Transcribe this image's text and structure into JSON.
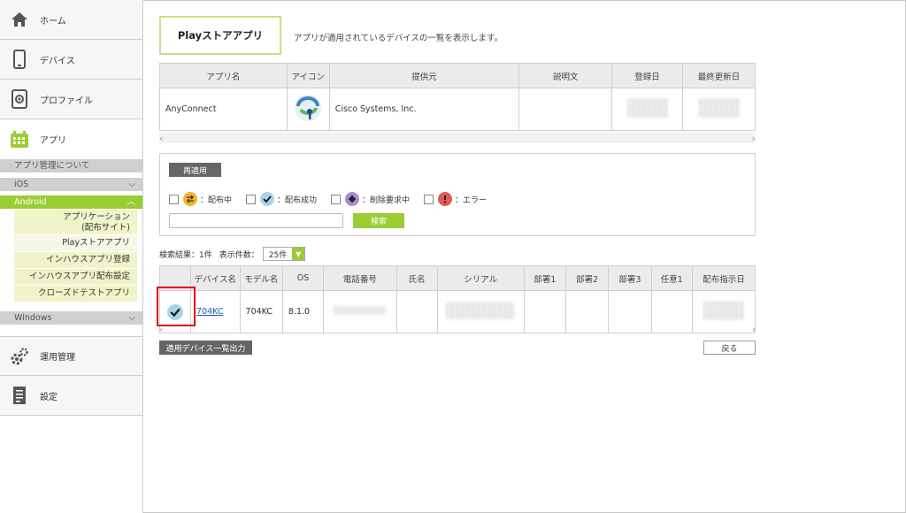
{
  "sidebar": {
    "home": "ホーム",
    "device": "デバイス",
    "profile": "プロファイル",
    "app": "アプリ",
    "about": "アプリ管理について",
    "ios": "iOS",
    "android": "Android",
    "android_links": [
      "アプリケーション\n(配布サイト)",
      "Playストアアプリ",
      "インハウスアプリ登録",
      "インハウスアプリ配布設定",
      "クローズドテストアプリ"
    ],
    "windows": "Windows",
    "ops": "運用管理",
    "settings": "設定"
  },
  "page": {
    "title": "Playストアアプリ",
    "description": "アプリが適用されているデバイスの一覧を表示します。"
  },
  "app_table": {
    "headers": [
      "アプリ名",
      "アイコン",
      "提供元",
      "説明文",
      "登録日",
      "最終更新日"
    ],
    "row": {
      "name": "AnyConnect",
      "provider": "Cisco Systems, Inc."
    }
  },
  "search": {
    "reapply_label": "再適用",
    "statuses": [
      "：配布中",
      "：配布成功",
      "：削除要求中",
      "：エラー"
    ],
    "search_button": "検索",
    "search_placeholder": ""
  },
  "results": {
    "count_label": "検索結果：1件",
    "per_page_label": "表示件数：",
    "per_page_value": "25件"
  },
  "device_table": {
    "headers": [
      "デバイス名",
      "モデル名",
      "OS",
      "電話番号",
      "氏名",
      "シリアル",
      "部署1",
      "部署2",
      "部署3",
      "任意1",
      "配布指示日"
    ],
    "row": {
      "device_name": "704KC",
      "model": "704KC",
      "os": "8.1.0"
    }
  },
  "buttons": {
    "export": "適用デバイス一覧出力",
    "back": "戻る"
  },
  "colors": {
    "accent": "#9acd32",
    "highlight": "#e60012"
  }
}
